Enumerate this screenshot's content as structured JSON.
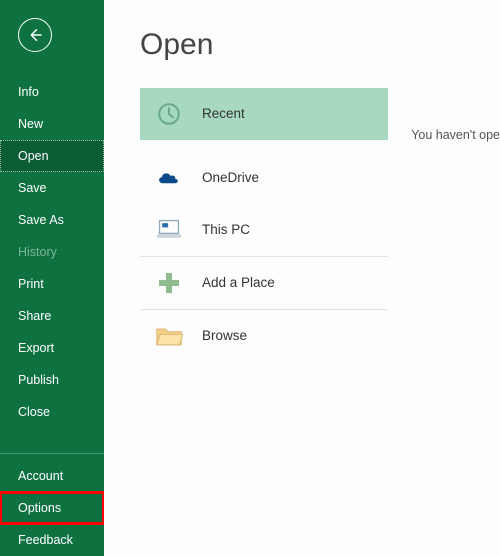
{
  "sidebar": {
    "items": [
      {
        "label": "Info"
      },
      {
        "label": "New"
      },
      {
        "label": "Open"
      },
      {
        "label": "Save"
      },
      {
        "label": "Save As"
      },
      {
        "label": "History"
      },
      {
        "label": "Print"
      },
      {
        "label": "Share"
      },
      {
        "label": "Export"
      },
      {
        "label": "Publish"
      },
      {
        "label": "Close"
      }
    ],
    "bottom": [
      {
        "label": "Account"
      },
      {
        "label": "Options"
      },
      {
        "label": "Feedback"
      }
    ]
  },
  "main": {
    "title": "Open",
    "sources": [
      {
        "label": "Recent"
      },
      {
        "label": "OneDrive"
      },
      {
        "label": "This PC"
      },
      {
        "label": "Add a Place"
      },
      {
        "label": "Browse"
      }
    ],
    "right_text": "You haven't ope"
  }
}
